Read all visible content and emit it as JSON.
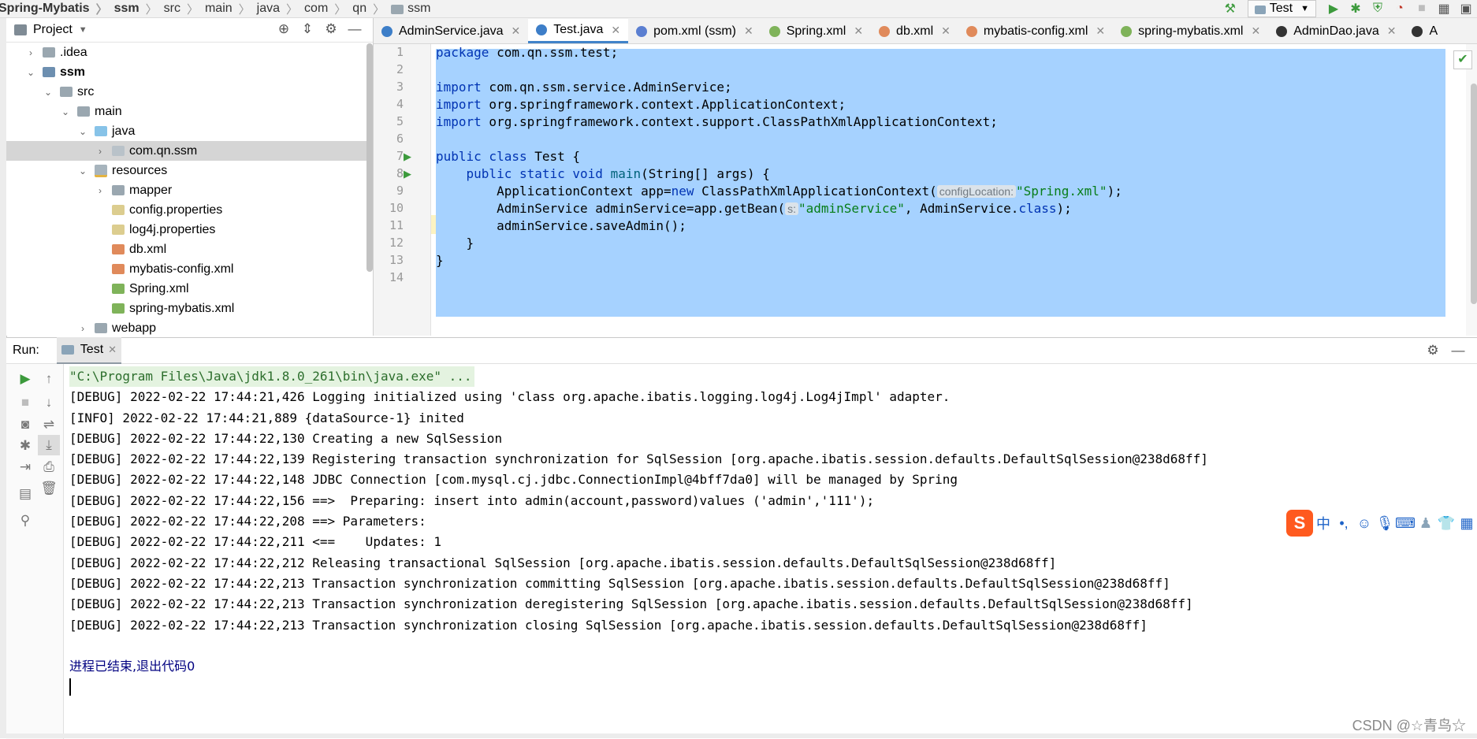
{
  "breadcrumb": [
    "Spring-Mybatis",
    "ssm",
    "src",
    "main",
    "java",
    "com",
    "qn",
    "ssm"
  ],
  "toolbar": {
    "run_config": "Test"
  },
  "project": {
    "title": "Project",
    "tree": [
      {
        "label": ".idea",
        "icon": "folder",
        "toggle": "›",
        "indent": 0
      },
      {
        "label": "ssm",
        "icon": "module",
        "toggle": "⌄",
        "indent": 0,
        "bold": true
      },
      {
        "label": "src",
        "icon": "folder",
        "toggle": "⌄",
        "indent": 1
      },
      {
        "label": "main",
        "icon": "folder",
        "toggle": "⌄",
        "indent": 2
      },
      {
        "label": "java",
        "icon": "java",
        "toggle": "⌄",
        "indent": 3
      },
      {
        "label": "com.qn.ssm",
        "icon": "pkg",
        "toggle": "›",
        "indent": 4,
        "selected": true
      },
      {
        "label": "resources",
        "icon": "res",
        "toggle": "⌄",
        "indent": 3
      },
      {
        "label": "mapper",
        "icon": "folder",
        "toggle": "›",
        "indent": 4
      },
      {
        "label": "config.properties",
        "icon": "props",
        "toggle": "",
        "indent": 4
      },
      {
        "label": "log4j.properties",
        "icon": "props",
        "toggle": "",
        "indent": 4
      },
      {
        "label": "db.xml",
        "icon": "xml",
        "toggle": "",
        "indent": 4
      },
      {
        "label": "mybatis-config.xml",
        "icon": "xml",
        "toggle": "",
        "indent": 4
      },
      {
        "label": "Spring.xml",
        "icon": "springxml",
        "toggle": "",
        "indent": 4
      },
      {
        "label": "spring-mybatis.xml",
        "icon": "springxml",
        "toggle": "",
        "indent": 4
      },
      {
        "label": "webapp",
        "icon": "folder",
        "toggle": "›",
        "indent": 3
      }
    ]
  },
  "tabs": [
    {
      "label": "AdminService.java",
      "icon_color": "#3d7ec8",
      "active": false
    },
    {
      "label": "Test.java",
      "icon_color": "#3d7ec8",
      "active": true
    },
    {
      "label": "pom.xml (ssm)",
      "icon_color": "#5b7fd1",
      "active": false
    },
    {
      "label": "Spring.xml",
      "icon_color": "#7fb35a",
      "active": false
    },
    {
      "label": "db.xml",
      "icon_color": "#e08a5b",
      "active": false
    },
    {
      "label": "mybatis-config.xml",
      "icon_color": "#e08a5b",
      "active": false
    },
    {
      "label": "spring-mybatis.xml",
      "icon_color": "#7fb35a",
      "active": false
    },
    {
      "label": "AdminDao.java",
      "icon_color": "#333333",
      "active": false
    },
    {
      "label": "A",
      "icon_color": "#333333",
      "active": false
    }
  ],
  "editor": {
    "line_numbers": [
      "1",
      "2",
      "3",
      "4",
      "5",
      "6",
      "7",
      "8",
      "9",
      "10",
      "11",
      "12",
      "13",
      "14"
    ],
    "lines": {
      "l1_kw": "package",
      "l1_rest": " com.qn.ssm.test;",
      "l3_kw": "import",
      "l3_rest": " com.qn.ssm.service.AdminService;",
      "l4_kw": "import",
      "l4_rest": " org.springframework.context.ApplicationContext;",
      "l5_kw": "import",
      "l5_rest": " org.springframework.context.support.ClassPathXmlApplicationContext;",
      "l7_kw": "public class",
      "l7_rest": " Test {",
      "l8_kw": "public static void",
      "l8_mth": "main",
      "l8_rest": "(String[] args) {",
      "l9_a": "ApplicationContext app=",
      "l9_kw": "new",
      "l9_b": " ClassPathXmlApplicationContext(",
      "l9_hint": "configLocation:",
      "l9_str": "\"Spring.xml\"",
      "l9_end": ");",
      "l10_a": "AdminService adminService=app.getBean(",
      "l10_hint": "s:",
      "l10_str": "\"adminService\"",
      "l10_b": ", AdminService.",
      "l10_kw": "class",
      "l10_end": ");",
      "l11": "adminService.saveAdmin();",
      "l12": "}",
      "l13": "}"
    }
  },
  "run": {
    "label": "Run:",
    "tab": "Test",
    "console": [
      "\"C:\\Program Files\\Java\\jdk1.8.0_261\\bin\\java.exe\" ...",
      "[DEBUG] 2022-02-22 17:44:21,426 Logging initialized using 'class org.apache.ibatis.logging.log4j.Log4jImpl' adapter.",
      "[INFO] 2022-02-22 17:44:21,889 {dataSource-1} inited",
      "[DEBUG] 2022-02-22 17:44:22,130 Creating a new SqlSession",
      "[DEBUG] 2022-02-22 17:44:22,139 Registering transaction synchronization for SqlSession [org.apache.ibatis.session.defaults.DefaultSqlSession@238d68ff]",
      "[DEBUG] 2022-02-22 17:44:22,148 JDBC Connection [com.mysql.cj.jdbc.ConnectionImpl@4bff7da0] will be managed by Spring",
      "[DEBUG] 2022-02-22 17:44:22,156 ==>  Preparing: insert into admin(account,password)values ('admin','111');",
      "[DEBUG] 2022-02-22 17:44:22,208 ==> Parameters: ",
      "[DEBUG] 2022-02-22 17:44:22,211 <==    Updates: 1",
      "[DEBUG] 2022-02-22 17:44:22,212 Releasing transactional SqlSession [org.apache.ibatis.session.defaults.DefaultSqlSession@238d68ff]",
      "[DEBUG] 2022-02-22 17:44:22,213 Transaction synchronization committing SqlSession [org.apache.ibatis.session.defaults.DefaultSqlSession@238d68ff]",
      "[DEBUG] 2022-02-22 17:44:22,213 Transaction synchronization deregistering SqlSession [org.apache.ibatis.session.defaults.DefaultSqlSession@238d68ff]",
      "[DEBUG] 2022-02-22 17:44:22,213 Transaction synchronization closing SqlSession [org.apache.ibatis.session.defaults.DefaultSqlSession@238d68ff]",
      "",
      "进程已结束,退出代码0"
    ]
  },
  "ime": {
    "lang": "中"
  },
  "watermark": "CSDN @☆青鸟☆"
}
